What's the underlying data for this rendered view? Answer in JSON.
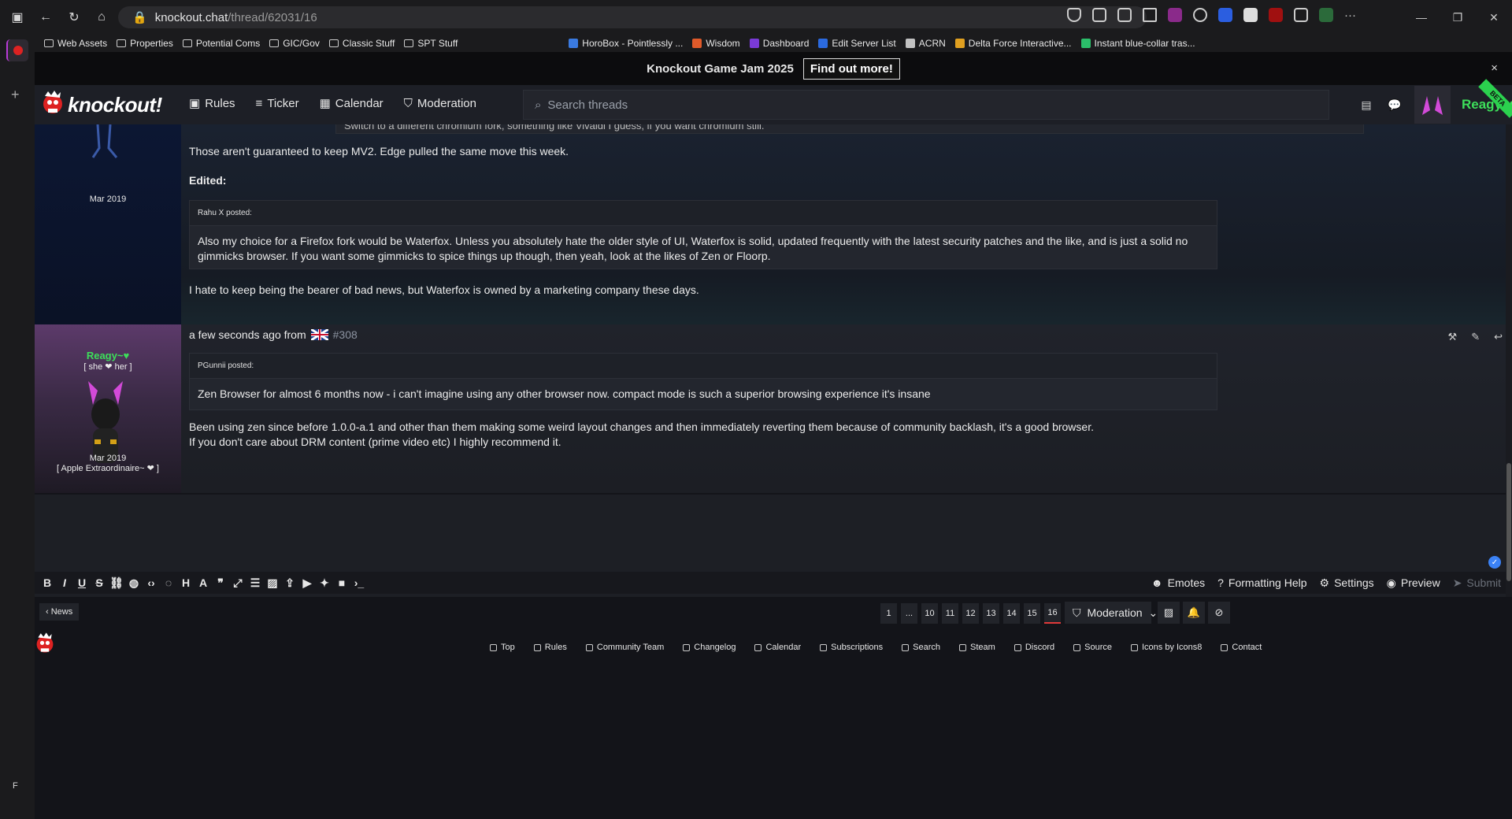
{
  "browser": {
    "url_host": "knockout.chat",
    "url_path": "/thread/62031/16",
    "bookmarks": [
      {
        "label": "Web Assets",
        "type": "folder"
      },
      {
        "label": "Properties",
        "type": "folder"
      },
      {
        "label": "Potential Coms",
        "type": "folder"
      },
      {
        "label": "GIC/Gov",
        "type": "folder"
      },
      {
        "label": "Classic Stuff",
        "type": "folder"
      },
      {
        "label": "SPT Stuff",
        "type": "folder"
      },
      {
        "label": "HoroBox - Pointlessly ...",
        "type": "link"
      },
      {
        "label": "Wisdom",
        "type": "link"
      },
      {
        "label": "Dashboard",
        "type": "link"
      },
      {
        "label": "Edit Server List",
        "type": "link"
      },
      {
        "label": "ACRN",
        "type": "link"
      },
      {
        "label": "Delta Force Interactive...",
        "type": "link"
      },
      {
        "label": "Instant blue-collar tras...",
        "type": "link"
      }
    ],
    "sidebar_letter": "F"
  },
  "banner": {
    "title": "Knockout Game Jam 2025",
    "button": "Find out more!",
    "close": "×"
  },
  "header": {
    "logo": "knockout!",
    "nav": [
      {
        "label": "Rules",
        "icon": "book-icon"
      },
      {
        "label": "Ticker",
        "icon": "list-icon"
      },
      {
        "label": "Calendar",
        "icon": "calendar-icon"
      },
      {
        "label": "Moderation",
        "icon": "shield-icon"
      }
    ],
    "search_placeholder": "Search threads",
    "username": "Reagy~♥",
    "beta": "BETA"
  },
  "post1": {
    "cut_line": "Switch to a different chromium fork, something like Vivaldi I guess, if you want chromium still.",
    "author_date": "Mar 2019",
    "para1": "Those aren't guaranteed to keep MV2. Edge pulled the same move this week.",
    "edited": "Edited:",
    "quote_header": "Rahu X  posted:",
    "quote_body": "Also my choice for a Firefox fork would be Waterfox. Unless you absolutely hate the older style of UI, Waterfox is solid, updated frequently with the latest security patches and the like, and is just a solid no gimmicks browser. If you want some gimmicks to spice things up though, then yeah, look at the likes of Zen or Floorp.",
    "para2": "I hate to keep being the bearer of bad news, but Waterfox is owned by a marketing company these days."
  },
  "post2": {
    "author": "Reagy~♥",
    "pronouns": "[ she ❤ her ]",
    "date": "Mar 2019",
    "title": "[ Apple Extraordinaire~ ❤ ]",
    "meta": "a few seconds ago from",
    "post_num": "#308",
    "quote_header": "PGunnii  posted:",
    "quote_body": "Zen Browser for almost 6 months now - i can't imagine using any other browser now. compact mode is such a superior browsing experience it's insane",
    "para1": "Been using zen since before 1.0.0-a.1 and other than them making some weird layout changes and then immediately reverting them because of community backlash, it's a good browser.",
    "para2": "If you don't care about DRM content (prime video etc) I highly recommend it."
  },
  "editor": {
    "toolbar_right": [
      {
        "label": "Emotes",
        "icon": "smile-icon"
      },
      {
        "label": "Formatting Help",
        "icon": "question-icon"
      },
      {
        "label": "Settings",
        "icon": "gear-icon"
      },
      {
        "label": "Preview",
        "icon": "eye-icon"
      },
      {
        "label": "Submit",
        "icon": "send-icon"
      }
    ]
  },
  "pagination": {
    "news": "‹ News",
    "pages": [
      "1",
      "...",
      "10",
      "11",
      "12",
      "13",
      "14",
      "15",
      "16"
    ],
    "current": "16",
    "moderation": "Moderation"
  },
  "footer": {
    "links": [
      "Top",
      "Rules",
      "Community Team",
      "Changelog",
      "Calendar",
      "Subscriptions",
      "Search",
      "Steam",
      "Discord",
      "Source",
      "Icons by Icons8",
      "Contact"
    ]
  },
  "colors": {
    "accent_green": "#3ddf5a",
    "page_active": "#e03a3a",
    "check_blue": "#3b82f6"
  }
}
